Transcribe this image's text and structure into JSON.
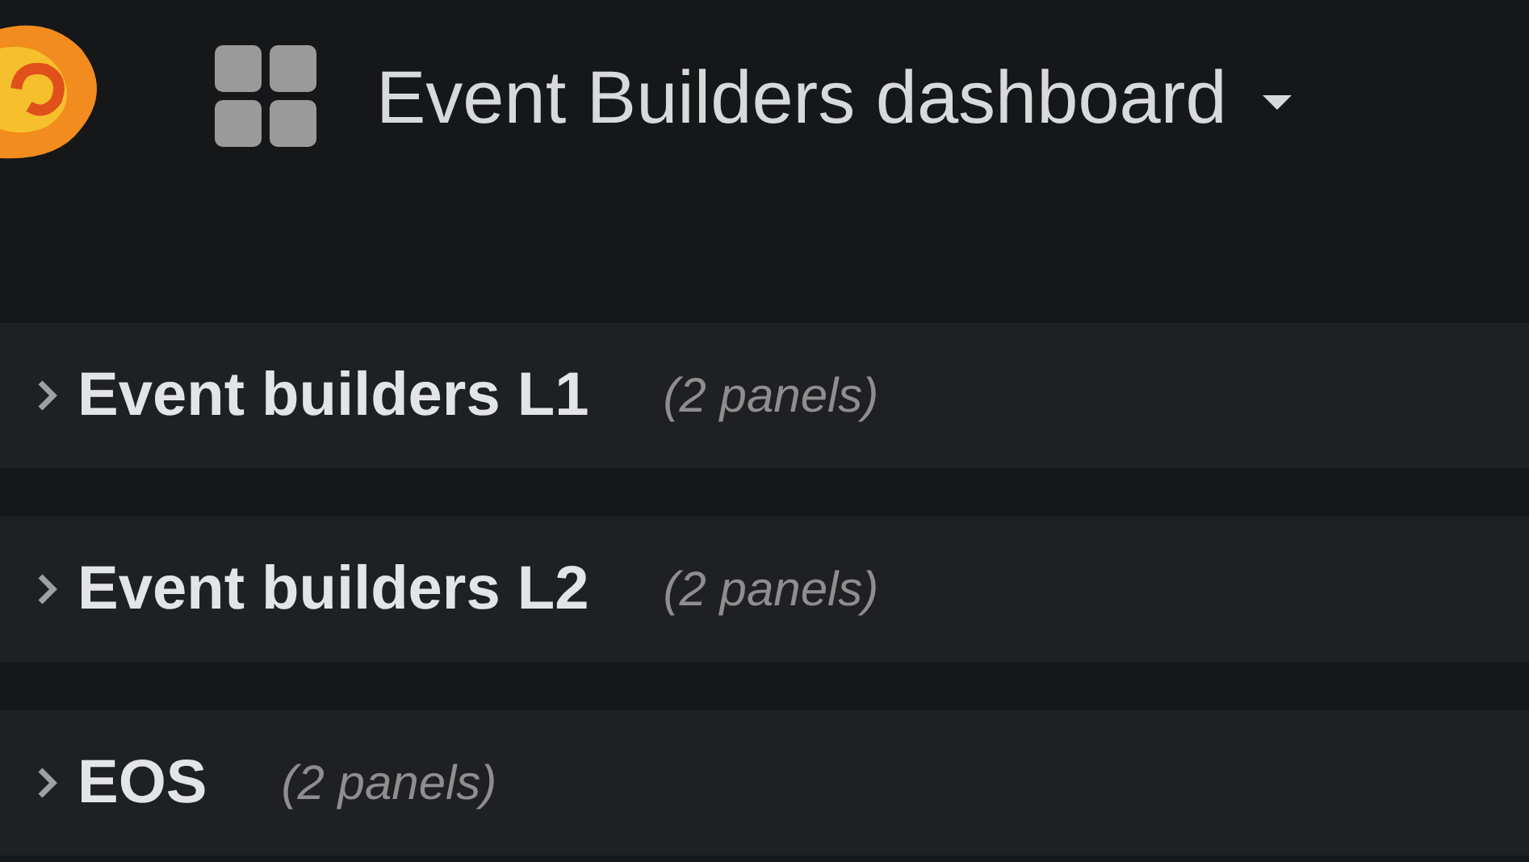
{
  "header": {
    "title": "Event Builders dashboard"
  },
  "rows": [
    {
      "title": "Event builders L1",
      "panels": "(2 panels)",
      "expanded": false
    },
    {
      "title": "Event builders L2",
      "panels": "(2 panels)",
      "expanded": false
    },
    {
      "title": "EOS",
      "panels": "(2 panels)",
      "expanded": false
    }
  ]
}
